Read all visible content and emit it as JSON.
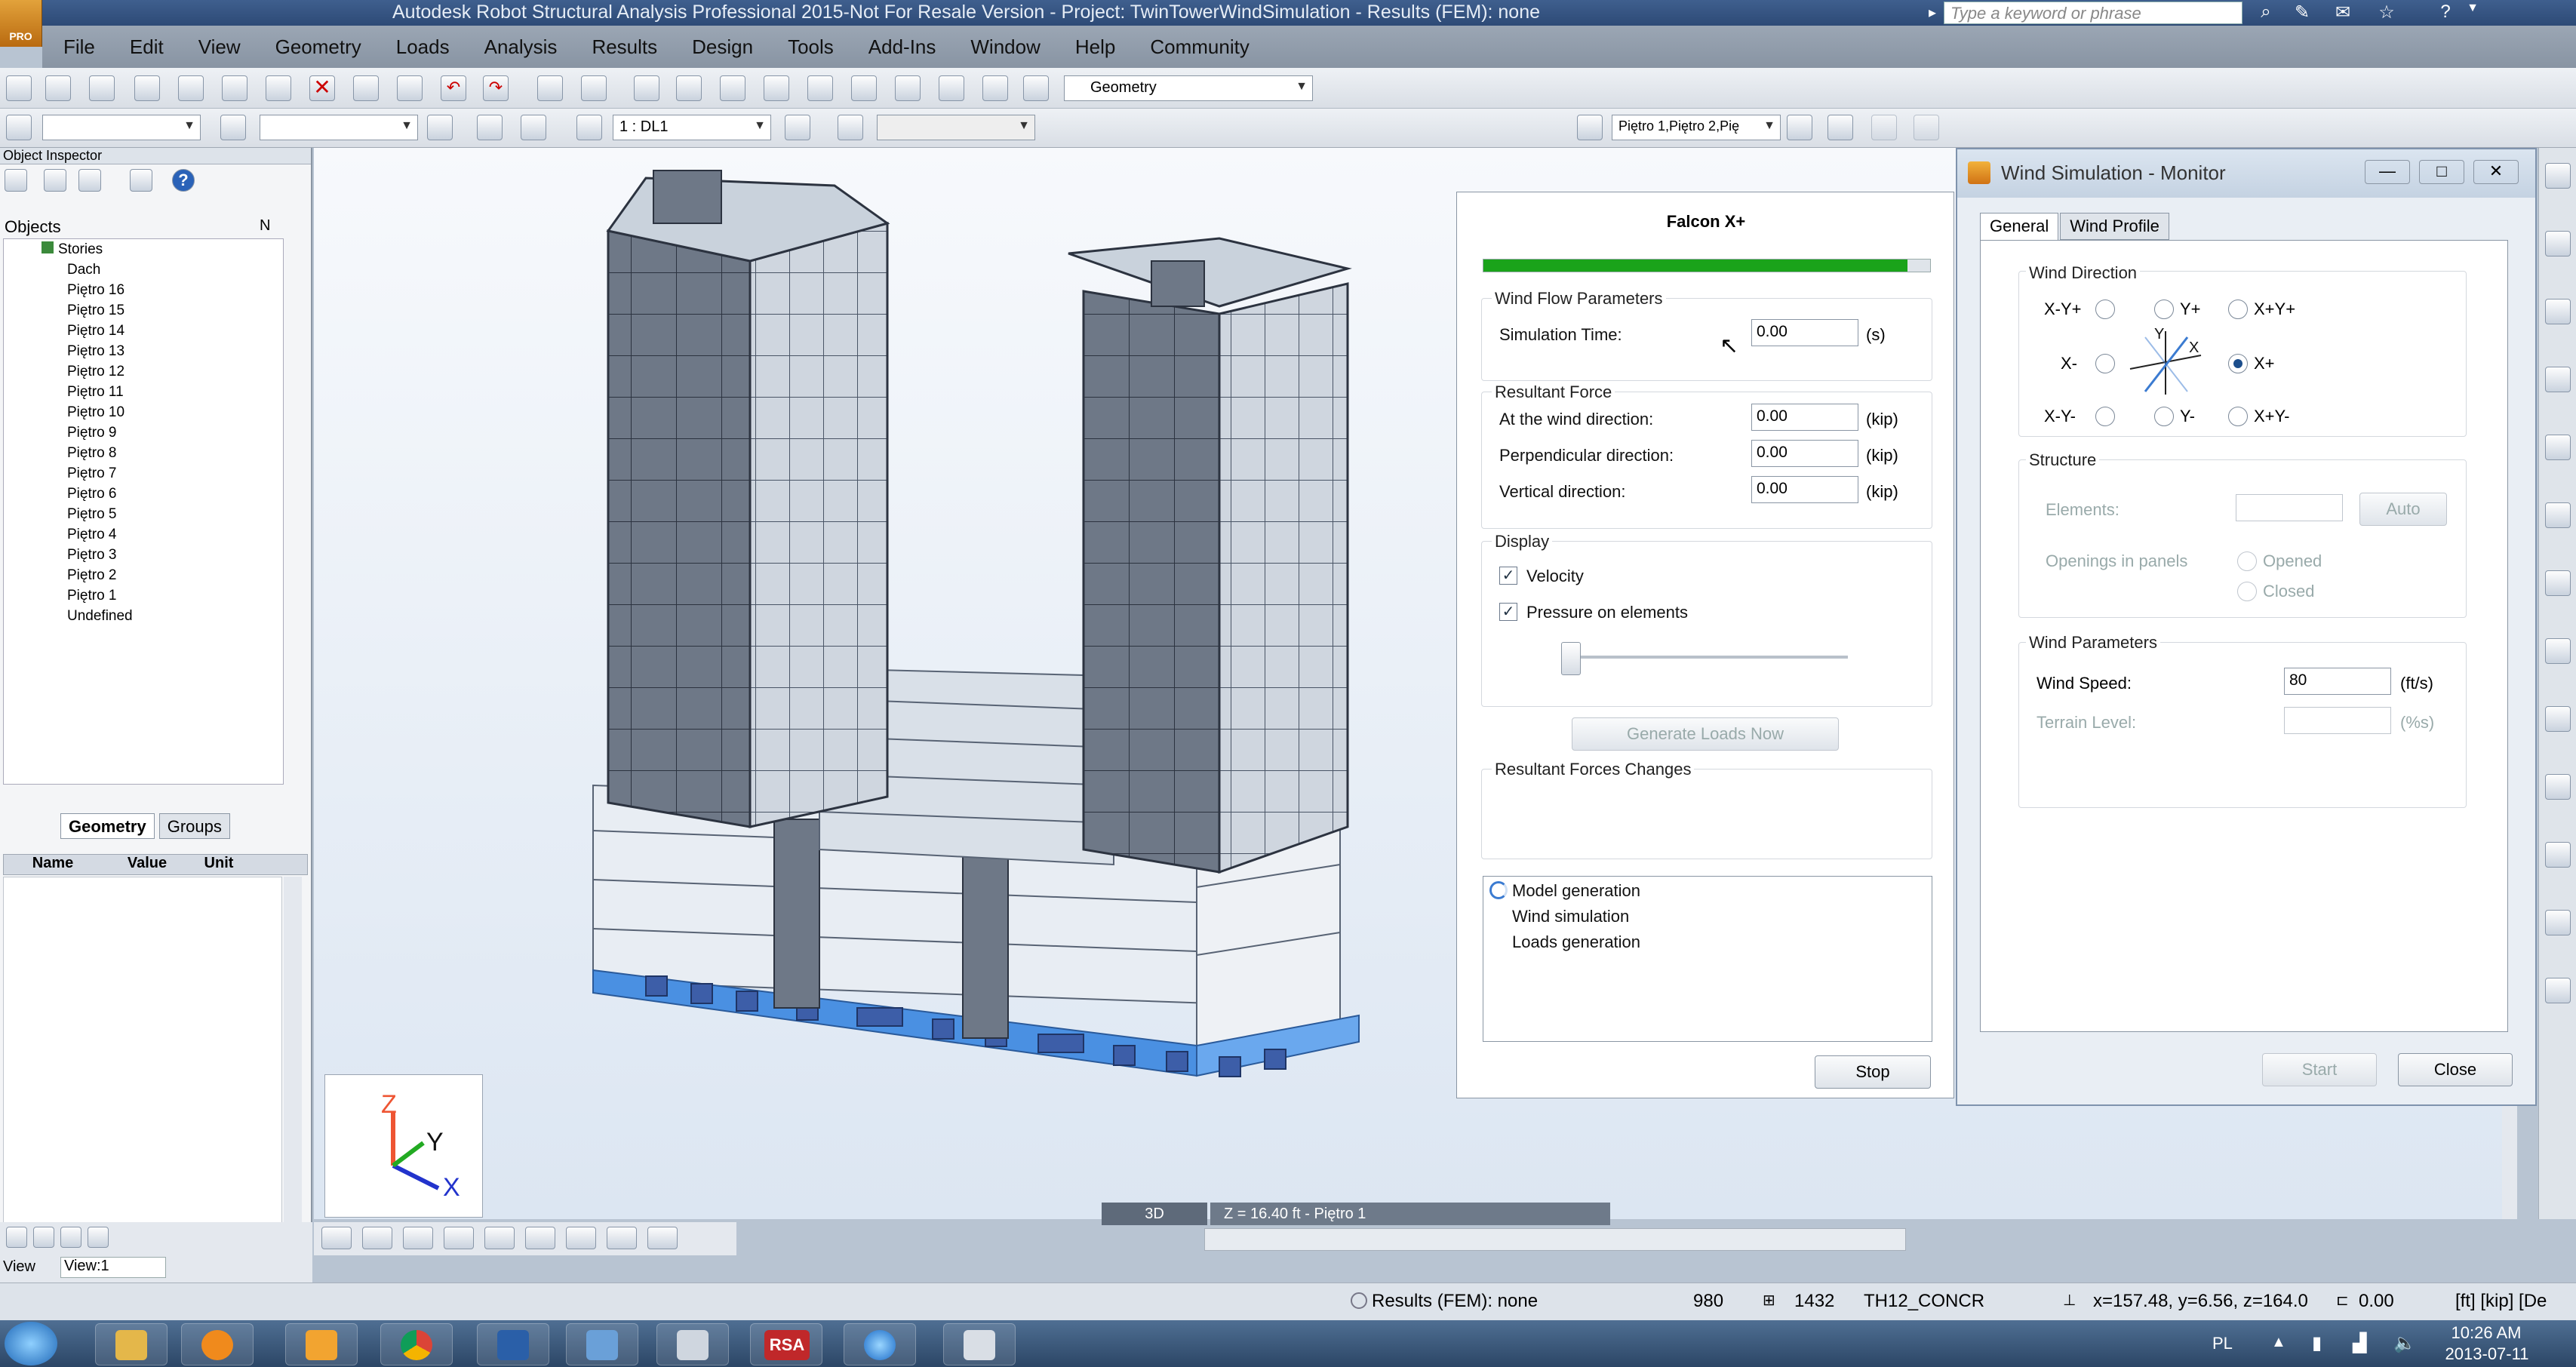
{
  "title": "Autodesk Robot Structural Analysis Professional 2015-Not For Resale Version - Project: TwinTowerWindSimulation - Results (FEM): none",
  "app_logo": "PRO",
  "search_placeholder": "Type a keyword or phrase",
  "menu": [
    "File",
    "Edit",
    "View",
    "Geometry",
    "Loads",
    "Analysis",
    "Results",
    "Design",
    "Tools",
    "Add-Ins",
    "Window",
    "Help",
    "Community"
  ],
  "toolbar": {
    "geometry_combo": "Geometry",
    "case_combo": "1 : DL1",
    "stories_combo": "Piętro 1,Piętro 2,Pię"
  },
  "inspector": {
    "title": "Object Inspector",
    "objects_header": "Objects",
    "objects_col": "N",
    "stories_label": "Stories",
    "items": [
      "Dach",
      "Piętro 16",
      "Piętro 15",
      "Piętro 14",
      "Piętro 13",
      "Piętro 12",
      "Piętro 11",
      "Piętro 10",
      "Piętro 9",
      "Piętro 8",
      "Piętro 7",
      "Piętro 6",
      "Piętro 5",
      "Piętro 4",
      "Piętro 3",
      "Piętro 2",
      "Piętro 1",
      "Undefined"
    ],
    "tabs": [
      "Geometry",
      "Groups"
    ],
    "prop_cols": [
      "Name",
      "Value",
      "Unit"
    ]
  },
  "viewport": {
    "view_mode": "3D",
    "story_label": "Z = 16.40 ft - Piętro 1",
    "axes": {
      "z": "Z",
      "y": "Y",
      "x": "X"
    }
  },
  "falcon": {
    "title": "Falcon X+",
    "progress": 0.95,
    "wind_flow_title": "Wind Flow Parameters",
    "sim_time_label": "Simulation Time:",
    "sim_time_value": "0.00",
    "sim_time_unit": "(s)",
    "resultant_title": "Resultant Force",
    "forces": [
      {
        "label": "At the wind direction:",
        "value": "0.00",
        "unit": "(kip)"
      },
      {
        "label": "Perpendicular direction:",
        "value": "0.00",
        "unit": "(kip)"
      },
      {
        "label": "Vertical direction:",
        "value": "0.00",
        "unit": "(kip)"
      }
    ],
    "display_title": "Display",
    "velocity_label": "Velocity",
    "pressure_label": "Pressure on elements",
    "generate_label": "Generate Loads Now",
    "changes_title": "Resultant Forces Changes",
    "steps": [
      "Model generation",
      "Wind simulation",
      "Loads generation"
    ],
    "stop_label": "Stop"
  },
  "monitor": {
    "title": "Wind Simulation - Monitor",
    "tabs": [
      "General",
      "Wind Profile"
    ],
    "wind_direction_title": "Wind Direction",
    "directions": {
      "xm_yp": "X-Y+",
      "yp": "Y+",
      "xp_yp": "X+Y+",
      "xm": "X-",
      "xp": "X+",
      "xm_ym": "X-Y-",
      "ym": "Y-",
      "xp_ym": "X+Y-"
    },
    "compass": {
      "y": "Y",
      "x": "X"
    },
    "structure_title": "Structure",
    "elements_label": "Elements:",
    "auto_label": "Auto",
    "openings_label": "Openings in panels",
    "opened_label": "Opened",
    "closed_label": "Closed",
    "wind_params_title": "Wind Parameters",
    "wind_speed_label": "Wind Speed:",
    "wind_speed_value": "80",
    "wind_speed_unit": "(ft/s)",
    "terrain_label": "Terrain Level:",
    "terrain_unit": "(%s)",
    "start_label": "Start",
    "close_label": "Close"
  },
  "view_bar": {
    "view_label": "View",
    "view_value": "View:1"
  },
  "status": {
    "results": "Results (FEM): none",
    "n1": "980",
    "n2": "1432",
    "material": "TH12_CONCR",
    "coords": "x=157.48, y=6.56, z=164.0",
    "angle": "0.00",
    "units": "[ft] [kip] [De"
  },
  "tray": {
    "lang": "PL",
    "time": "10:26 AM",
    "date": "2013-07-11"
  },
  "colors": {
    "titlebar": "#2d4a76",
    "menubar": "#8894a3",
    "progress": "#1aa31a",
    "building": "#6e7887",
    "slab": "#c9d2dc",
    "base": "#4a90e2"
  }
}
